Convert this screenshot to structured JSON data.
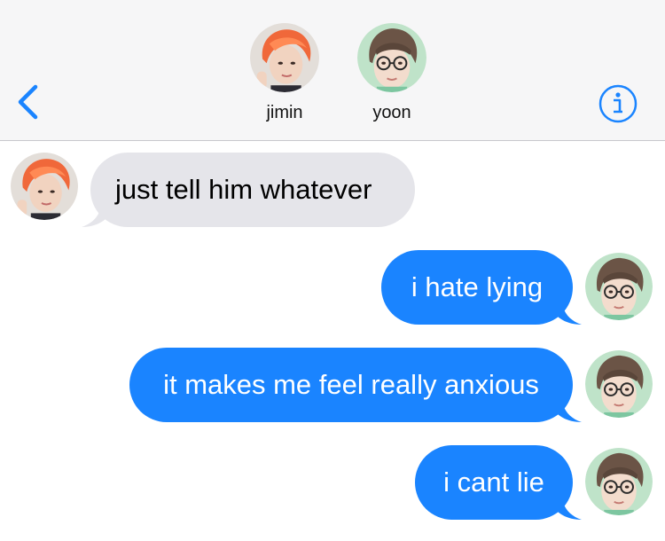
{
  "header": {
    "back_icon": "chevron-left-icon",
    "info_icon": "info-icon",
    "accent": "#1a84ff",
    "participants": [
      {
        "name": "jimin",
        "hair": "#f0683a"
      },
      {
        "name": "yoon",
        "hair": "#6b5446"
      }
    ]
  },
  "colors": {
    "incoming_bubble": "#e5e5ea",
    "outgoing_bubble": "#1a84ff",
    "header_bg": "#f6f6f7"
  },
  "messages": [
    {
      "sender": "jimin",
      "direction": "incoming",
      "text": "just tell him whatever"
    },
    {
      "sender": "yoon",
      "direction": "outgoing",
      "text": "i hate lying"
    },
    {
      "sender": "yoon",
      "direction": "outgoing",
      "text": "it makes me feel really anxious"
    },
    {
      "sender": "yoon",
      "direction": "outgoing",
      "text": "i cant lie"
    }
  ]
}
